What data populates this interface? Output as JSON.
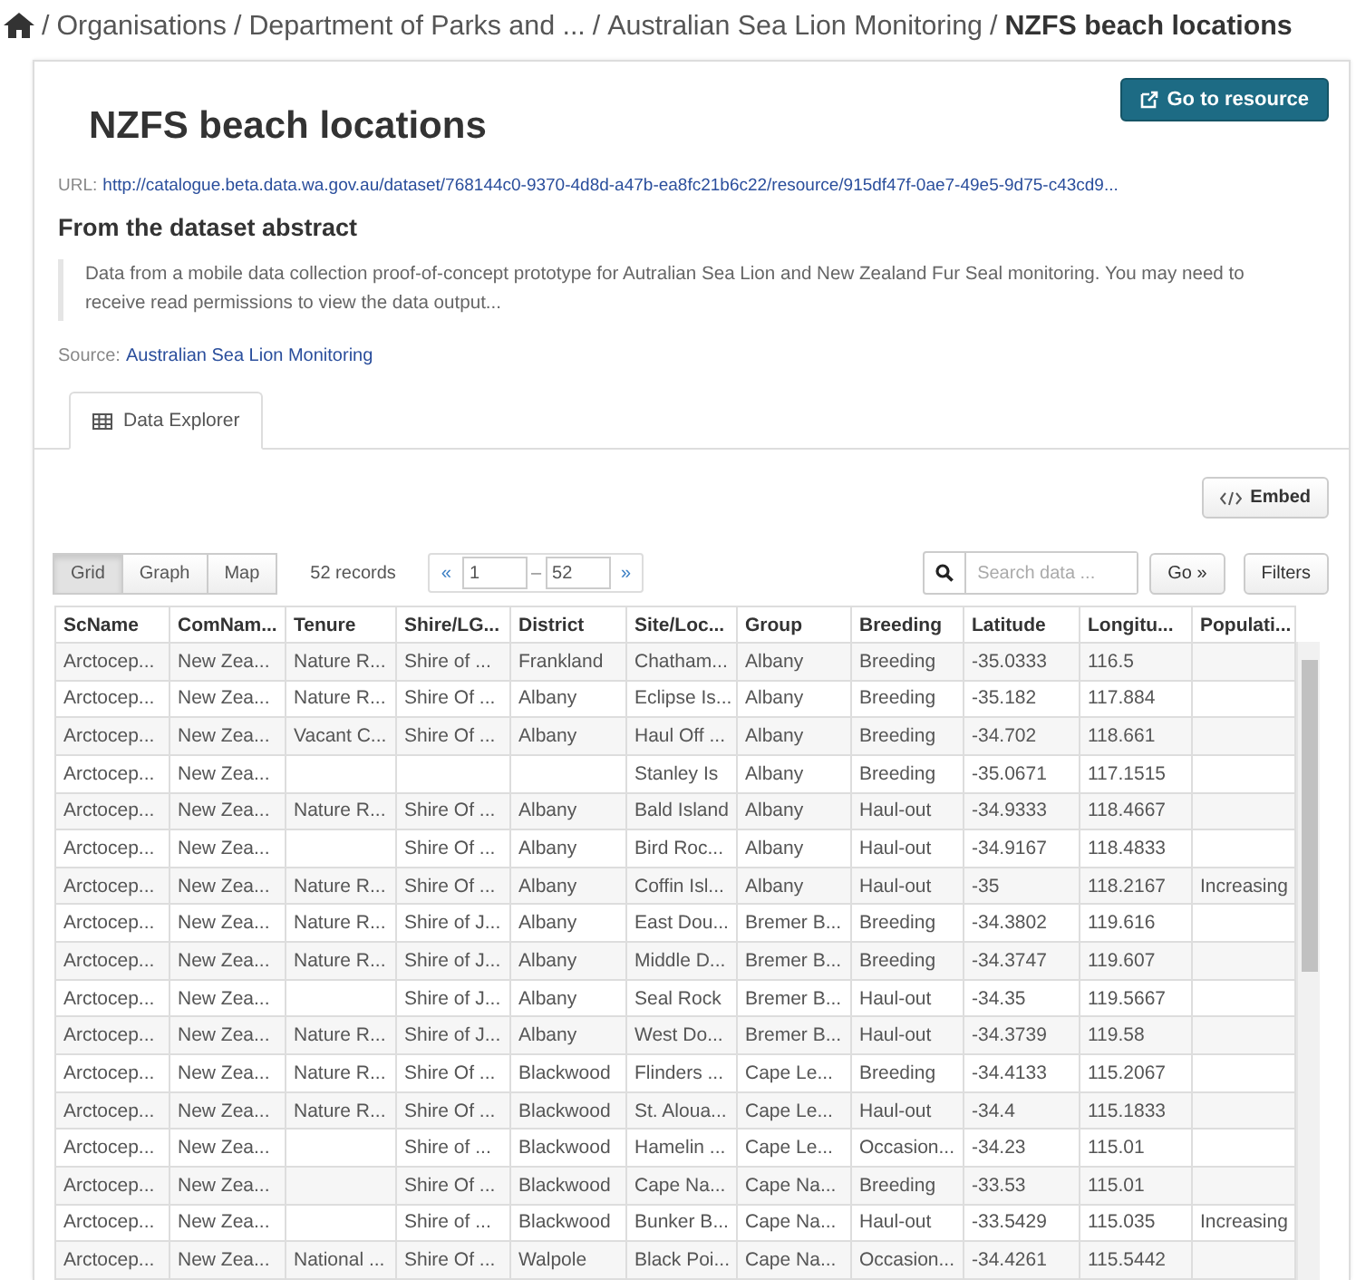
{
  "breadcrumb_separator": "/",
  "breadcrumb": [
    {
      "text": "Organisations"
    },
    {
      "text": "Department of Parks and ..."
    },
    {
      "text": "Australian Sea Lion Monitoring"
    },
    {
      "text": "NZFS beach locations",
      "current": true
    }
  ],
  "title": "NZFS beach locations",
  "resource_button": "Go to resource",
  "url": {
    "label": "URL:",
    "link": "http://catalogue.beta.data.wa.gov.au/dataset/768144c0-9370-4d8d-a47b-ea8fc21b6c22/resource/915df47f-0ae7-49e5-9d75-c43cd9..."
  },
  "abstract_heading": "From the dataset abstract",
  "abstract": "Data from a mobile data collection proof-of-concept prototype for Autralian Sea Lion and New Zealand Fur Seal monitoring. You may need to receive read permissions to view the data output...",
  "source": {
    "label": "Source:",
    "link": "Australian Sea Lion Monitoring"
  },
  "tabs": [
    {
      "label": "Data Explorer",
      "selected": true
    }
  ],
  "embed_button": "Embed",
  "views": [
    {
      "label": "Grid",
      "selected": true
    },
    {
      "label": "Graph",
      "selected": false
    },
    {
      "label": "Map",
      "selected": false
    }
  ],
  "record_count": "52 records",
  "pager": {
    "prev": "«",
    "from": "1",
    "separator": "–",
    "to": "52",
    "next": "»"
  },
  "search": {
    "placeholder": "Search data ...",
    "go": "Go »"
  },
  "filters_button": "Filters",
  "table": {
    "columns": [
      "ScName",
      "ComNam...",
      "Tenure",
      "Shire/LG...",
      "District",
      "Site/Loc...",
      "Group",
      "Breeding",
      "Latitude",
      "Longitu...",
      "Populati..."
    ],
    "rows": [
      [
        "Arctocep...",
        "New Zea...",
        "Nature R...",
        "Shire of ...",
        "Frankland",
        "Chatham...",
        "Albany",
        "Breeding",
        "-35.0333",
        "116.5",
        ""
      ],
      [
        "Arctocep...",
        "New Zea...",
        "Nature R...",
        "Shire Of ...",
        "Albany",
        "Eclipse Is...",
        "Albany",
        "Breeding",
        "-35.182",
        "117.884",
        ""
      ],
      [
        "Arctocep...",
        "New Zea...",
        "Vacant C...",
        "Shire Of ...",
        "Albany",
        "Haul Off ...",
        "Albany",
        "Breeding",
        "-34.702",
        "118.661",
        ""
      ],
      [
        "Arctocep...",
        "New Zea...",
        "",
        "",
        "",
        "Stanley Is",
        "Albany",
        "Breeding",
        "-35.0671",
        "117.1515",
        ""
      ],
      [
        "Arctocep...",
        "New Zea...",
        "Nature R...",
        "Shire Of ...",
        "Albany",
        "Bald Island",
        "Albany",
        "Haul-out",
        "-34.9333",
        "118.4667",
        ""
      ],
      [
        "Arctocep...",
        "New Zea...",
        "",
        "Shire Of ...",
        "Albany",
        "Bird Roc...",
        "Albany",
        "Haul-out",
        "-34.9167",
        "118.4833",
        ""
      ],
      [
        "Arctocep...",
        "New Zea...",
        "Nature R...",
        "Shire Of ...",
        "Albany",
        "Coffin Isl...",
        "Albany",
        "Haul-out",
        "-35",
        "118.2167",
        "Increasing"
      ],
      [
        "Arctocep...",
        "New Zea...",
        "Nature R...",
        "Shire of J...",
        "Albany",
        "East Dou...",
        "Bremer B...",
        "Breeding",
        "-34.3802",
        "119.616",
        ""
      ],
      [
        "Arctocep...",
        "New Zea...",
        "Nature R...",
        "Shire of J...",
        "Albany",
        "Middle D...",
        "Bremer B...",
        "Breeding",
        "-34.3747",
        "119.607",
        ""
      ],
      [
        "Arctocep...",
        "New Zea...",
        "",
        "Shire of J...",
        "Albany",
        "Seal Rock",
        "Bremer B...",
        "Haul-out",
        "-34.35",
        "119.5667",
        ""
      ],
      [
        "Arctocep...",
        "New Zea...",
        "Nature R...",
        "Shire of J...",
        "Albany",
        "West Do...",
        "Bremer B...",
        "Haul-out",
        "-34.3739",
        "119.58",
        ""
      ],
      [
        "Arctocep...",
        "New Zea...",
        "Nature R...",
        "Shire Of ...",
        "Blackwood",
        "Flinders ...",
        "Cape Le...",
        "Breeding",
        "-34.4133",
        "115.2067",
        ""
      ],
      [
        "Arctocep...",
        "New Zea...",
        "Nature R...",
        "Shire Of ...",
        "Blackwood",
        "St. Aloua...",
        "Cape Le...",
        "Haul-out",
        "-34.4",
        "115.1833",
        ""
      ],
      [
        "Arctocep...",
        "New Zea...",
        "",
        "Shire of ...",
        "Blackwood",
        "Hamelin ...",
        "Cape Le...",
        "Occasion...",
        "-34.23",
        "115.01",
        ""
      ],
      [
        "Arctocep...",
        "New Zea...",
        "",
        "Shire Of ...",
        "Blackwood",
        "Cape Na...",
        "Cape Na...",
        "Breeding",
        "-33.53",
        "115.01",
        ""
      ],
      [
        "Arctocep...",
        "New Zea...",
        "",
        "Shire of ...",
        "Blackwood",
        "Bunker B...",
        "Cape Na...",
        "Haul-out",
        "-33.5429",
        "115.035",
        "Increasing"
      ],
      [
        "Arctocep...",
        "New Zea...",
        "National ...",
        "Shire Of ...",
        "Walpole",
        "Black Poi...",
        "Cape Na...",
        "Occasion...",
        "-34.4261",
        "115.5442",
        ""
      ]
    ]
  }
}
